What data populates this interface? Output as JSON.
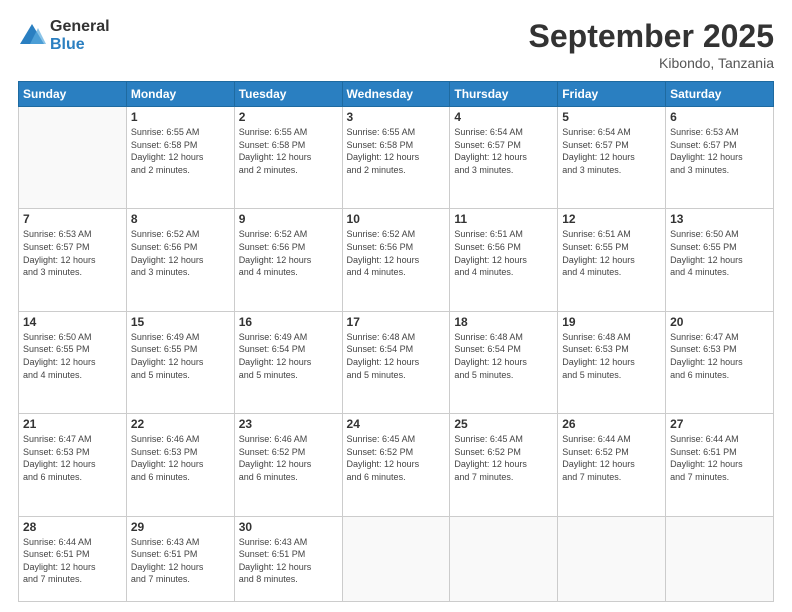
{
  "logo": {
    "general": "General",
    "blue": "Blue"
  },
  "header": {
    "month": "September 2025",
    "location": "Kibondo, Tanzania"
  },
  "weekdays": [
    "Sunday",
    "Monday",
    "Tuesday",
    "Wednesday",
    "Thursday",
    "Friday",
    "Saturday"
  ],
  "weeks": [
    [
      {
        "day": "",
        "sunrise": "",
        "sunset": "",
        "daylight": ""
      },
      {
        "day": "1",
        "sunrise": "Sunrise: 6:55 AM",
        "sunset": "Sunset: 6:58 PM",
        "daylight": "Daylight: 12 hours and 2 minutes."
      },
      {
        "day": "2",
        "sunrise": "Sunrise: 6:55 AM",
        "sunset": "Sunset: 6:58 PM",
        "daylight": "Daylight: 12 hours and 2 minutes."
      },
      {
        "day": "3",
        "sunrise": "Sunrise: 6:55 AM",
        "sunset": "Sunset: 6:58 PM",
        "daylight": "Daylight: 12 hours and 2 minutes."
      },
      {
        "day": "4",
        "sunrise": "Sunrise: 6:54 AM",
        "sunset": "Sunset: 6:57 PM",
        "daylight": "Daylight: 12 hours and 3 minutes."
      },
      {
        "day": "5",
        "sunrise": "Sunrise: 6:54 AM",
        "sunset": "Sunset: 6:57 PM",
        "daylight": "Daylight: 12 hours and 3 minutes."
      },
      {
        "day": "6",
        "sunrise": "Sunrise: 6:53 AM",
        "sunset": "Sunset: 6:57 PM",
        "daylight": "Daylight: 12 hours and 3 minutes."
      }
    ],
    [
      {
        "day": "7",
        "sunrise": "Sunrise: 6:53 AM",
        "sunset": "Sunset: 6:57 PM",
        "daylight": "Daylight: 12 hours and 3 minutes."
      },
      {
        "day": "8",
        "sunrise": "Sunrise: 6:52 AM",
        "sunset": "Sunset: 6:56 PM",
        "daylight": "Daylight: 12 hours and 3 minutes."
      },
      {
        "day": "9",
        "sunrise": "Sunrise: 6:52 AM",
        "sunset": "Sunset: 6:56 PM",
        "daylight": "Daylight: 12 hours and 4 minutes."
      },
      {
        "day": "10",
        "sunrise": "Sunrise: 6:52 AM",
        "sunset": "Sunset: 6:56 PM",
        "daylight": "Daylight: 12 hours and 4 minutes."
      },
      {
        "day": "11",
        "sunrise": "Sunrise: 6:51 AM",
        "sunset": "Sunset: 6:56 PM",
        "daylight": "Daylight: 12 hours and 4 minutes."
      },
      {
        "day": "12",
        "sunrise": "Sunrise: 6:51 AM",
        "sunset": "Sunset: 6:55 PM",
        "daylight": "Daylight: 12 hours and 4 minutes."
      },
      {
        "day": "13",
        "sunrise": "Sunrise: 6:50 AM",
        "sunset": "Sunset: 6:55 PM",
        "daylight": "Daylight: 12 hours and 4 minutes."
      }
    ],
    [
      {
        "day": "14",
        "sunrise": "Sunrise: 6:50 AM",
        "sunset": "Sunset: 6:55 PM",
        "daylight": "Daylight: 12 hours and 4 minutes."
      },
      {
        "day": "15",
        "sunrise": "Sunrise: 6:49 AM",
        "sunset": "Sunset: 6:55 PM",
        "daylight": "Daylight: 12 hours and 5 minutes."
      },
      {
        "day": "16",
        "sunrise": "Sunrise: 6:49 AM",
        "sunset": "Sunset: 6:54 PM",
        "daylight": "Daylight: 12 hours and 5 minutes."
      },
      {
        "day": "17",
        "sunrise": "Sunrise: 6:48 AM",
        "sunset": "Sunset: 6:54 PM",
        "daylight": "Daylight: 12 hours and 5 minutes."
      },
      {
        "day": "18",
        "sunrise": "Sunrise: 6:48 AM",
        "sunset": "Sunset: 6:54 PM",
        "daylight": "Daylight: 12 hours and 5 minutes."
      },
      {
        "day": "19",
        "sunrise": "Sunrise: 6:48 AM",
        "sunset": "Sunset: 6:53 PM",
        "daylight": "Daylight: 12 hours and 5 minutes."
      },
      {
        "day": "20",
        "sunrise": "Sunrise: 6:47 AM",
        "sunset": "Sunset: 6:53 PM",
        "daylight": "Daylight: 12 hours and 6 minutes."
      }
    ],
    [
      {
        "day": "21",
        "sunrise": "Sunrise: 6:47 AM",
        "sunset": "Sunset: 6:53 PM",
        "daylight": "Daylight: 12 hours and 6 minutes."
      },
      {
        "day": "22",
        "sunrise": "Sunrise: 6:46 AM",
        "sunset": "Sunset: 6:53 PM",
        "daylight": "Daylight: 12 hours and 6 minutes."
      },
      {
        "day": "23",
        "sunrise": "Sunrise: 6:46 AM",
        "sunset": "Sunset: 6:52 PM",
        "daylight": "Daylight: 12 hours and 6 minutes."
      },
      {
        "day": "24",
        "sunrise": "Sunrise: 6:45 AM",
        "sunset": "Sunset: 6:52 PM",
        "daylight": "Daylight: 12 hours and 6 minutes."
      },
      {
        "day": "25",
        "sunrise": "Sunrise: 6:45 AM",
        "sunset": "Sunset: 6:52 PM",
        "daylight": "Daylight: 12 hours and 7 minutes."
      },
      {
        "day": "26",
        "sunrise": "Sunrise: 6:44 AM",
        "sunset": "Sunset: 6:52 PM",
        "daylight": "Daylight: 12 hours and 7 minutes."
      },
      {
        "day": "27",
        "sunrise": "Sunrise: 6:44 AM",
        "sunset": "Sunset: 6:51 PM",
        "daylight": "Daylight: 12 hours and 7 minutes."
      }
    ],
    [
      {
        "day": "28",
        "sunrise": "Sunrise: 6:44 AM",
        "sunset": "Sunset: 6:51 PM",
        "daylight": "Daylight: 12 hours and 7 minutes."
      },
      {
        "day": "29",
        "sunrise": "Sunrise: 6:43 AM",
        "sunset": "Sunset: 6:51 PM",
        "daylight": "Daylight: 12 hours and 7 minutes."
      },
      {
        "day": "30",
        "sunrise": "Sunrise: 6:43 AM",
        "sunset": "Sunset: 6:51 PM",
        "daylight": "Daylight: 12 hours and 8 minutes."
      },
      {
        "day": "",
        "sunrise": "",
        "sunset": "",
        "daylight": ""
      },
      {
        "day": "",
        "sunrise": "",
        "sunset": "",
        "daylight": ""
      },
      {
        "day": "",
        "sunrise": "",
        "sunset": "",
        "daylight": ""
      },
      {
        "day": "",
        "sunrise": "",
        "sunset": "",
        "daylight": ""
      }
    ]
  ]
}
